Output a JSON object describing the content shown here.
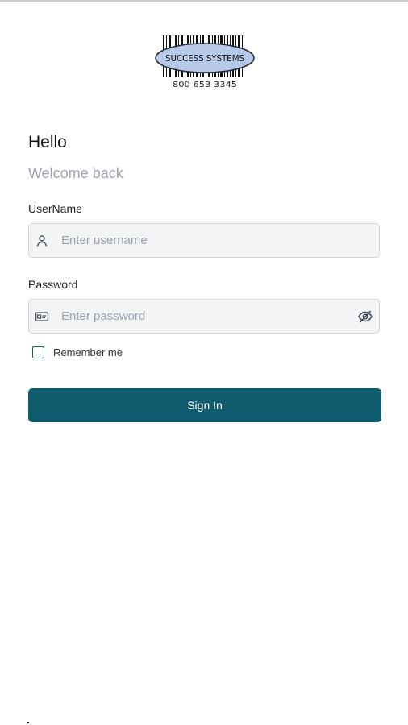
{
  "logo": {
    "company_name": "SUCCESS SYSTEMS",
    "phone": "800 653 3345",
    "icon": "barcode-oval-logo"
  },
  "header": {
    "greeting": "Hello",
    "subtitle": "Welcome back"
  },
  "form": {
    "username": {
      "label": "UserName",
      "placeholder": "Enter username",
      "value": "",
      "icon": "user-icon"
    },
    "password": {
      "label": "Password",
      "placeholder": "Enter password",
      "value": "",
      "icon": "id-card-icon",
      "toggle_icon": "eye-off-icon"
    },
    "remember": {
      "label": "Remember me",
      "checked": false
    },
    "submit_label": "Sign In"
  },
  "colors": {
    "primary": "#0f5c6e",
    "input_bg": "#f3f4f6",
    "muted_text": "#9ca3af",
    "logo_oval": "#b7c9e8"
  }
}
